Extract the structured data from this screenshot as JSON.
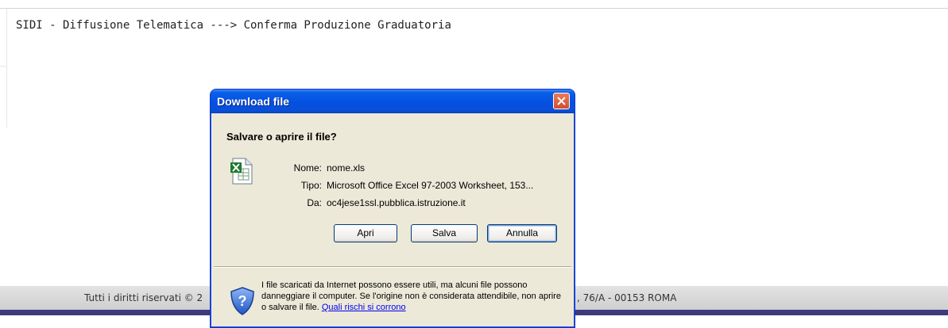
{
  "page": {
    "title": "SIDI - Diffusione Telematica ---> Conferma Produzione Graduatoria",
    "footer_left": "Tutti i diritti riservati © 2",
    "footer_right": ", 76/A - 00153 ROMA"
  },
  "dialog": {
    "title": "Download file",
    "question": "Salvare o aprire il file?",
    "fields": [
      {
        "label": "Nome:",
        "value": "nome.xls"
      },
      {
        "label": "Tipo:",
        "value": "Microsoft Office Excel 97-2003 Worksheet, 153..."
      },
      {
        "label": "Da:",
        "value": "oc4jese1ssl.pubblica.istruzione.it"
      }
    ],
    "buttons": {
      "open": "Apri",
      "save": "Salva",
      "cancel": "Annulla"
    },
    "warning_text": "I file scaricati da Internet possono essere utili, ma alcuni file possono danneggiare il computer. Se l'origine non è considerata attendibile, non aprire o salvare il file.",
    "risk_link": "Quali rischi si corrono",
    "icons": {
      "file": "excel-file-icon",
      "security": "security-shield-icon",
      "close": "close-icon"
    }
  }
}
